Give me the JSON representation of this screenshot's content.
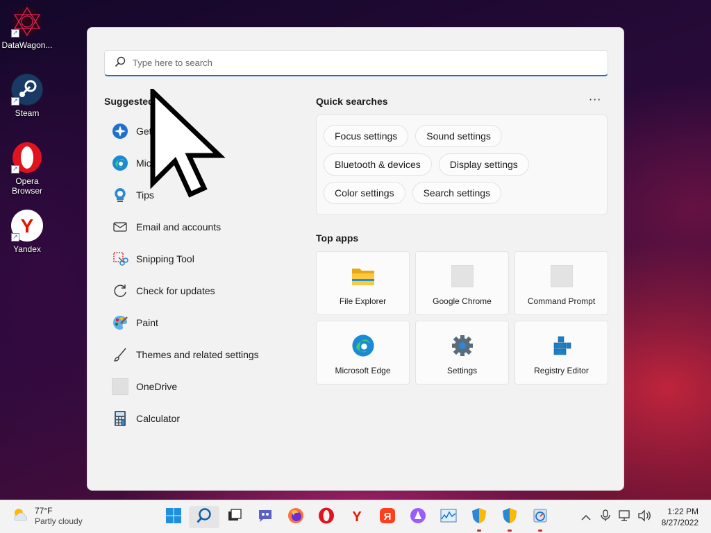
{
  "desktop": {
    "icons": [
      {
        "label": "DataWagon..."
      },
      {
        "label": "Steam"
      },
      {
        "label": "Opera Browser"
      },
      {
        "label": "Yandex"
      }
    ]
  },
  "search": {
    "placeholder": "Type here to search"
  },
  "suggested": {
    "heading": "Suggested",
    "items": [
      {
        "label": "Get",
        "icon": "get-started-icon"
      },
      {
        "label": "Mic",
        "icon": "edge-icon"
      },
      {
        "label": "Tips",
        "icon": "tips-icon"
      },
      {
        "label": "Email and accounts",
        "icon": "mail-icon"
      },
      {
        "label": "Snipping Tool",
        "icon": "snipping-tool-icon"
      },
      {
        "label": "Check for updates",
        "icon": "refresh-icon"
      },
      {
        "label": "Paint",
        "icon": "paint-icon"
      },
      {
        "label": "Themes and related settings",
        "icon": "brush-icon"
      },
      {
        "label": "OneDrive",
        "icon": "placeholder-icon"
      },
      {
        "label": "Calculator",
        "icon": "calculator-icon"
      }
    ]
  },
  "quick_searches": {
    "heading": "Quick searches",
    "more": "···",
    "chips": [
      [
        "Focus settings",
        "Sound settings"
      ],
      [
        "Bluetooth & devices",
        "Display settings"
      ],
      [
        "Color settings",
        "Search settings"
      ]
    ]
  },
  "top_apps": {
    "heading": "Top apps",
    "apps": [
      {
        "label": "File Explorer",
        "icon": "folder-icon"
      },
      {
        "label": "Google Chrome",
        "icon": "placeholder-icon"
      },
      {
        "label": "Command Prompt",
        "icon": "placeholder-icon"
      },
      {
        "label": "Microsoft Edge",
        "icon": "edge-icon"
      },
      {
        "label": "Settings",
        "icon": "gear-icon"
      },
      {
        "label": "Registry Editor",
        "icon": "registry-icon"
      }
    ]
  },
  "taskbar": {
    "weather": {
      "temp": "77°F",
      "condition": "Partly cloudy"
    },
    "clock": {
      "time": "1:22 PM",
      "date": "8/27/2022"
    }
  },
  "colors": {
    "accent": "#1f6fb5",
    "panel_bg": "#f2f2f2",
    "taskbar_bg": "#f3f3f3"
  }
}
